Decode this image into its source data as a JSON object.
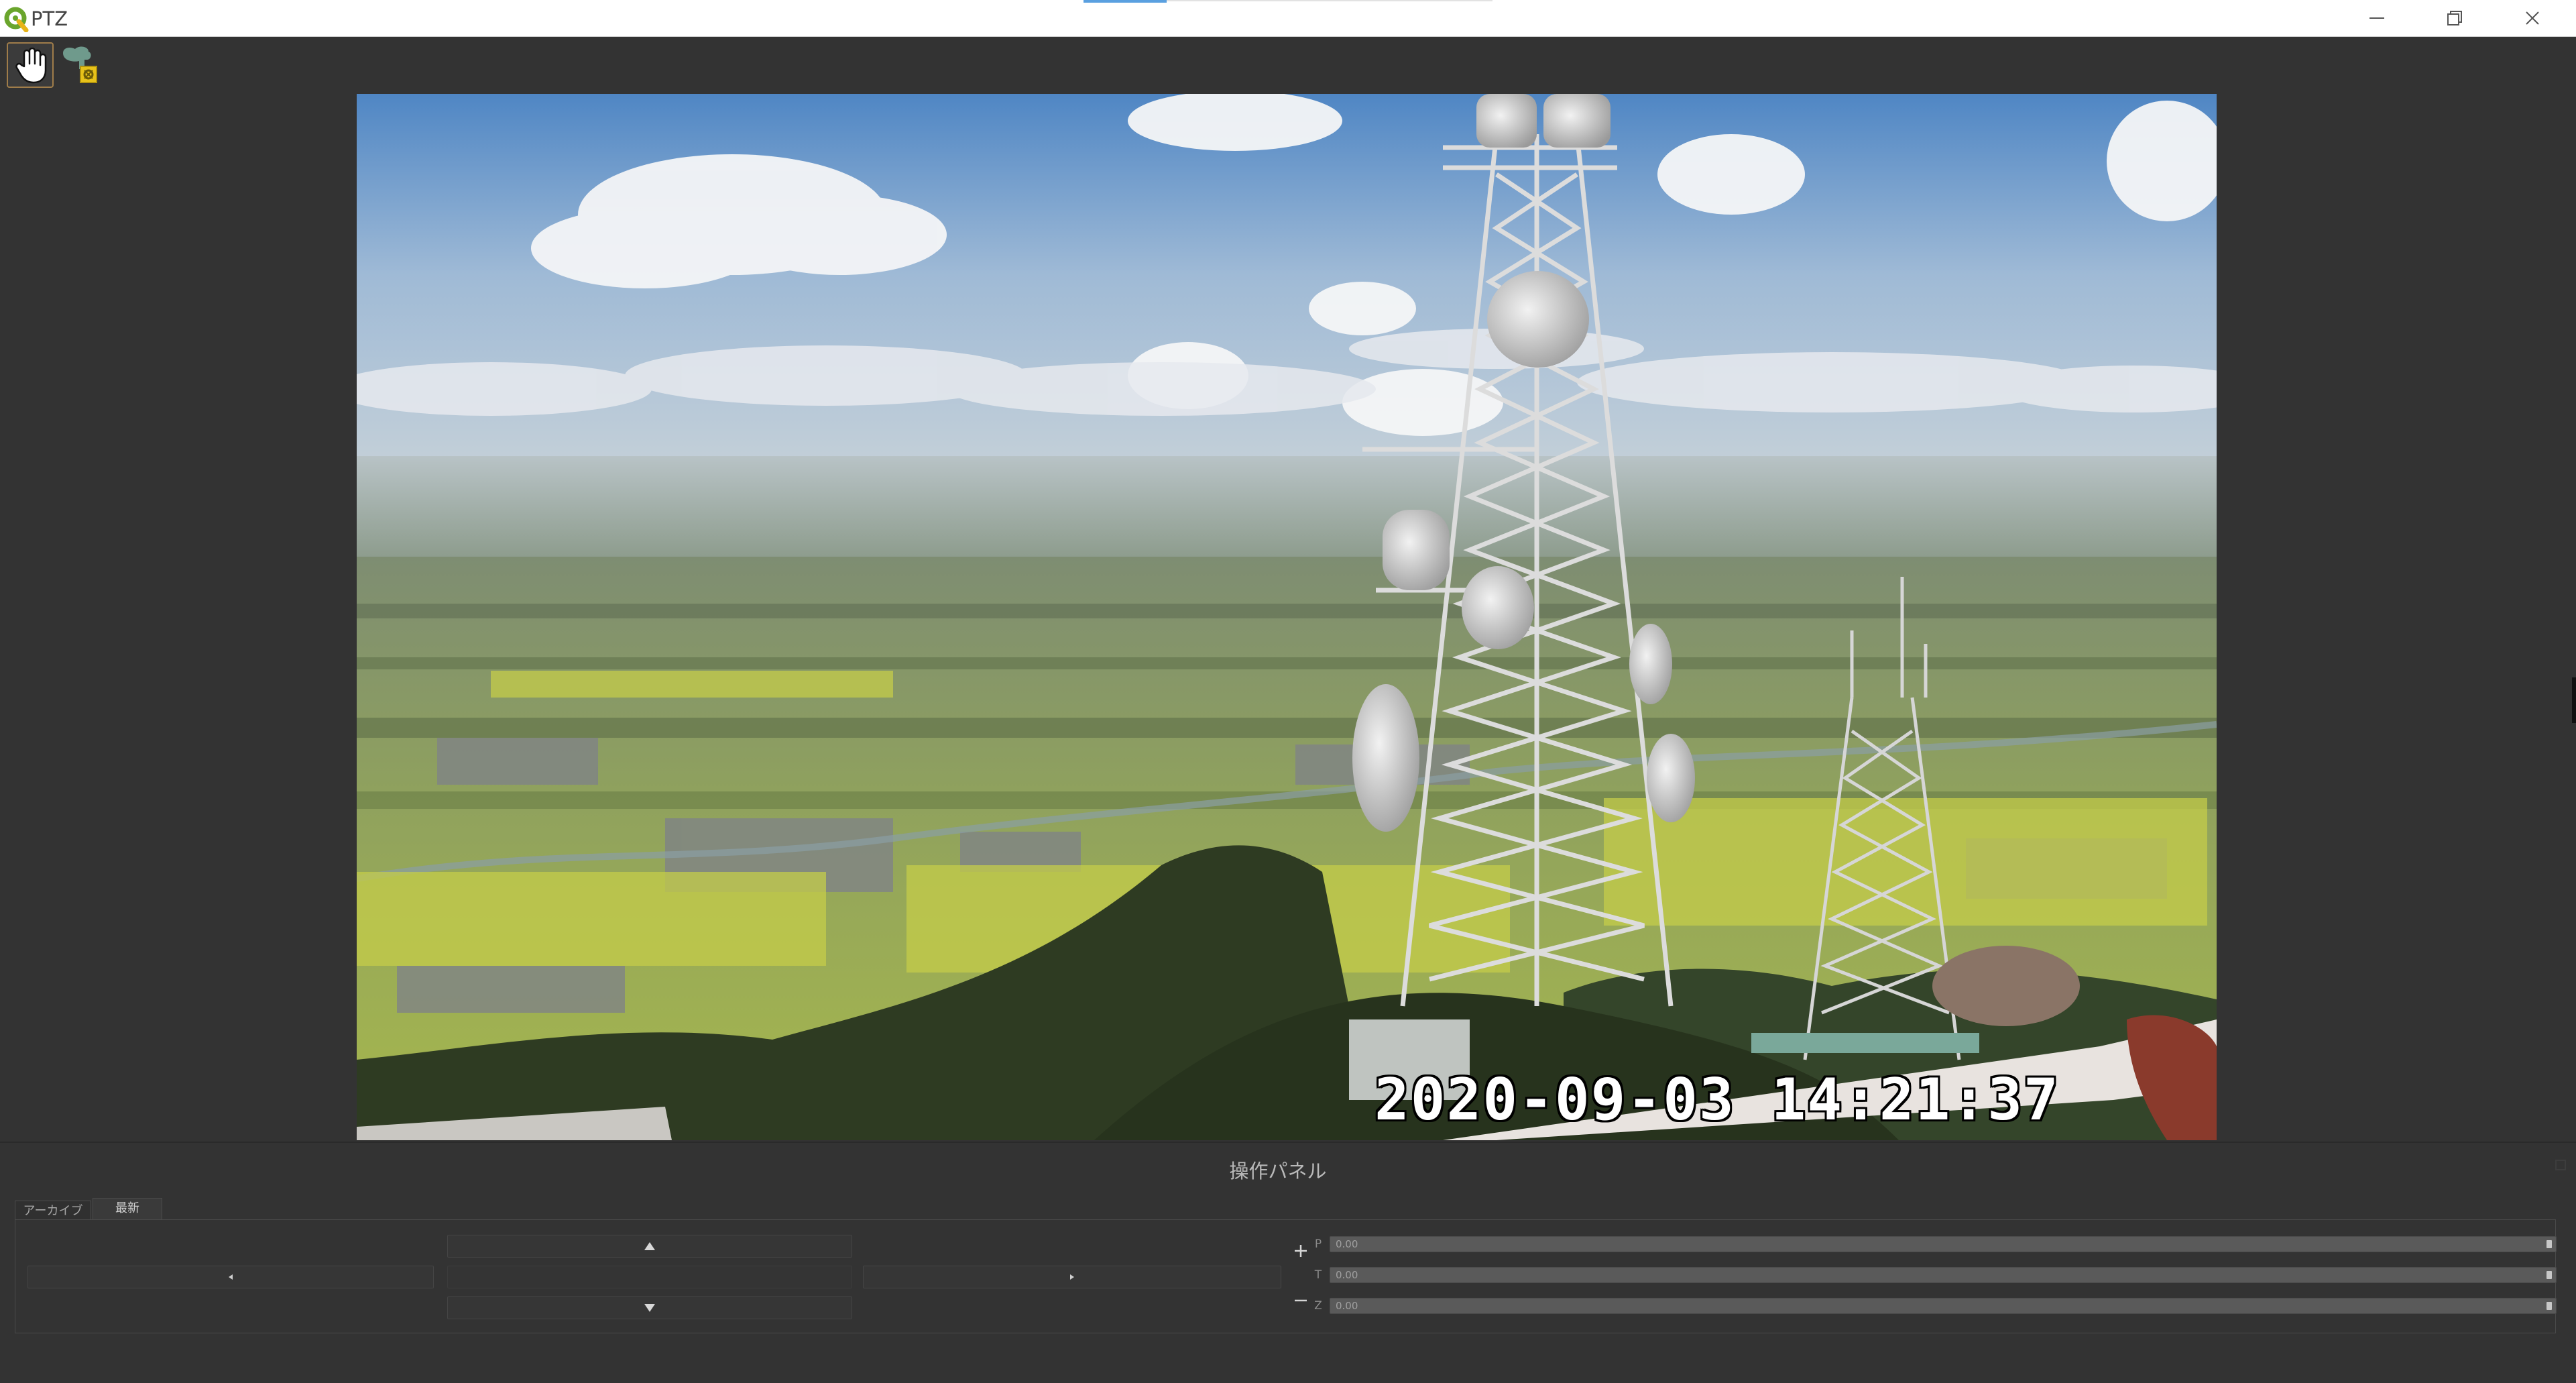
{
  "window": {
    "title": "PTZ",
    "app_icon": "q-logo-icon",
    "controls": [
      "minimize-icon",
      "restore-icon",
      "close-icon"
    ]
  },
  "toolbar": {
    "tools": [
      {
        "name": "hand-pan-tool",
        "icon": "hand-cursor-icon",
        "selected": true
      },
      {
        "name": "map-layer-tool",
        "icon": "map-layer-icon",
        "selected": false
      }
    ]
  },
  "video": {
    "scene": "camera-feed",
    "timestamp": "2020-09-03 14:21:37"
  },
  "panel": {
    "title": "操作パネル",
    "tabs": [
      {
        "label": "アーカイブ",
        "active": false
      },
      {
        "label": "最新",
        "active": true
      }
    ],
    "direction_buttons": [
      "up-arrow-icon",
      "left-arrow-icon",
      "right-arrow-icon",
      "down-arrow-icon"
    ],
    "zoom_buttons": [
      "plus-icon",
      "minus-icon"
    ],
    "sliders": {
      "pan": {
        "label": "P",
        "value": "0.00"
      },
      "tilt": {
        "label": "T",
        "value": "0.00"
      },
      "zoom": {
        "label": "Z",
        "value": "0.00"
      }
    }
  },
  "colors": {
    "background": "#333333",
    "titlebar": "#ffffff",
    "accent": "#5aa0e0",
    "selected_tool_border": "#a07d4a"
  }
}
